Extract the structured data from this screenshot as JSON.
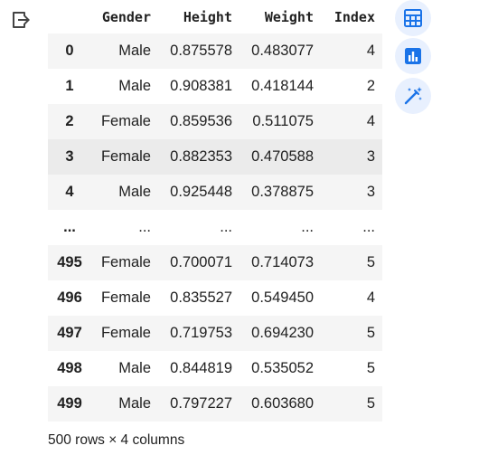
{
  "output_icon": "output-exit-icon",
  "table": {
    "headers": [
      "",
      "Gender",
      "Height",
      "Weight",
      "Index"
    ],
    "rows": [
      [
        "0",
        "Male",
        "0.875578",
        "0.483077",
        "4"
      ],
      [
        "1",
        "Male",
        "0.908381",
        "0.418144",
        "2"
      ],
      [
        "2",
        "Female",
        "0.859536",
        "0.511075",
        "4"
      ],
      [
        "3",
        "Female",
        "0.882353",
        "0.470588",
        "3"
      ],
      [
        "4",
        "Male",
        "0.925448",
        "0.378875",
        "3"
      ],
      [
        "...",
        "...",
        "...",
        "...",
        "..."
      ],
      [
        "495",
        "Female",
        "0.700071",
        "0.714073",
        "5"
      ],
      [
        "496",
        "Female",
        "0.835527",
        "0.549450",
        "4"
      ],
      [
        "497",
        "Female",
        "0.719753",
        "0.694230",
        "5"
      ],
      [
        "498",
        "Male",
        "0.844819",
        "0.535052",
        "5"
      ],
      [
        "499",
        "Male",
        "0.797227",
        "0.603680",
        "5"
      ]
    ]
  },
  "dimensions_note": "500 rows × 4 columns",
  "side_buttons": [
    {
      "icon": "table-icon"
    },
    {
      "icon": "bar-chart-icon"
    },
    {
      "icon": "magic-wand-icon"
    }
  ],
  "colors": {
    "accent": "#1a73e8",
    "button_bg": "#e8f0fe",
    "row_stripe": "#f5f5f5",
    "row_hover": "#ebebeb"
  }
}
